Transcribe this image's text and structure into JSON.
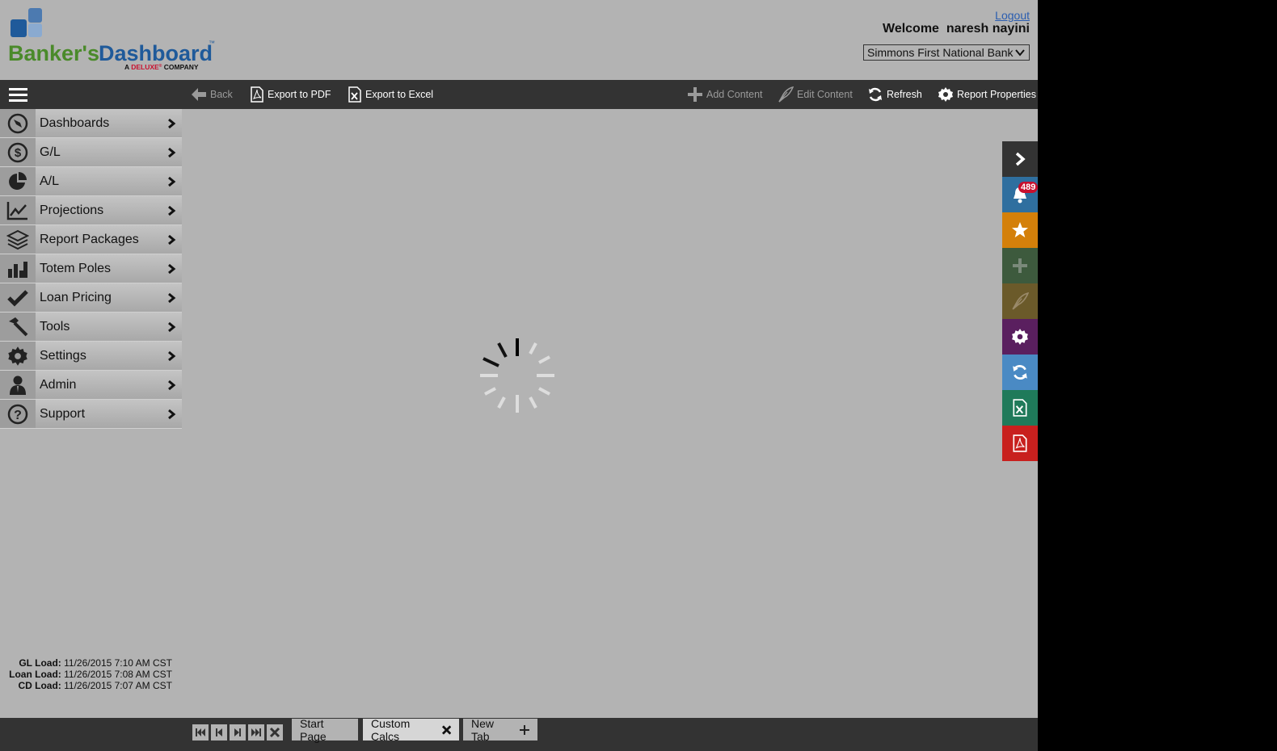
{
  "header": {
    "logo_text_part1": "Banker's",
    "logo_text_part2": "Dashboard",
    "logo_tm": "™",
    "logo_tagline_a": "A ",
    "logo_tagline_brand": "DELUXE",
    "logo_tagline_reg": "®",
    "logo_tagline_b": " COMPANY",
    "logout": "Logout",
    "welcome": "Welcome  naresh nayini",
    "bank_selected": "Simmons First National Bank"
  },
  "toolbar": {
    "back": "Back",
    "export_pdf": "Export to PDF",
    "export_excel": "Export to Excel",
    "add_content": "Add Content",
    "edit_content": "Edit Content",
    "refresh": "Refresh",
    "report_properties": "Report Properties"
  },
  "sidebar": {
    "items": [
      {
        "label": "Dashboards",
        "icon": "compass-icon"
      },
      {
        "label": "G/L",
        "icon": "dollar-icon"
      },
      {
        "label": "A/L",
        "icon": "pie-icon"
      },
      {
        "label": "Projections",
        "icon": "line-chart-icon"
      },
      {
        "label": "Report Packages",
        "icon": "layers-icon"
      },
      {
        "label": "Totem Poles",
        "icon": "bar-chart-icon"
      },
      {
        "label": "Loan Pricing",
        "icon": "check-icon"
      },
      {
        "label": "Tools",
        "icon": "hammer-icon"
      },
      {
        "label": "Settings",
        "icon": "gear-icon"
      },
      {
        "label": "Admin",
        "icon": "user-icon"
      },
      {
        "label": "Support",
        "icon": "question-icon"
      }
    ],
    "loads": {
      "gl_label": "GL Load:",
      "gl_value": "11/26/2015 7:10 AM CST",
      "loan_label": "Loan Load:",
      "loan_value": "11/26/2015 7:08 AM CST",
      "cd_label": "CD Load:",
      "cd_value": "11/26/2015 7:07 AM CST"
    }
  },
  "rail": {
    "notifications_count": "489",
    "colors": {
      "collapse": "#333333",
      "notifications": "#2f6f9f",
      "favorites": "#d4800a",
      "add": "#3d5a3d",
      "edit": "#6b5a2a",
      "settings": "#5a1f5f",
      "refresh": "#4a8ac4",
      "excel": "#1f7a5a",
      "pdf": "#c8201e"
    }
  },
  "tabs": {
    "start_page": "Start Page",
    "custom_calcs": "Custom Calcs",
    "new_tab": "New Tab"
  },
  "colors": {
    "background": "#b3b3b3",
    "toolbar": "#333333",
    "logo_blue": "#1f5a9a",
    "logo_green": "#4a8a2a"
  }
}
